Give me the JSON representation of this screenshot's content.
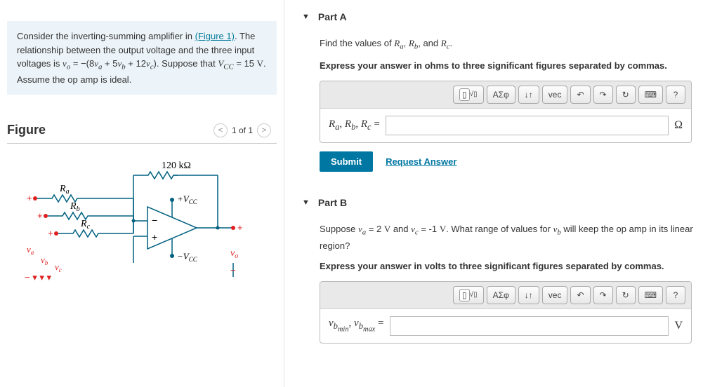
{
  "prompt": {
    "line1_pre": "Consider the inverting-summing amplifier in ",
    "figure_link": "(Figure 1)",
    "line1_post": ". The relationship between the output voltage and the three input voltages is ",
    "equation": "vₒ = −(8vₐ + 5v_b + 12v_c)",
    "suppose": ". Suppose that ",
    "vcc": "V_CC = 15 V",
    "assume": ". Assume the op amp is ideal."
  },
  "figure": {
    "title": "Figure",
    "page": "1 of 1",
    "r_feedback": "120 kΩ",
    "r_a": "Rₐ",
    "r_b": "R_b",
    "r_c": "R_c",
    "v_a": "vₐ",
    "v_b": "v_b",
    "v_c": "v_c",
    "v_o": "vₒ",
    "plus_vcc": "+V_CC",
    "minus_vcc": "−V_CC"
  },
  "partA": {
    "title": "Part A",
    "question_pre": "Find the values of ",
    "vars": "Rₐ, R_b, and R_c",
    "question_post": ".",
    "instruction": "Express your answer in ohms to three significant figures separated by commas.",
    "var_label": "Rₐ, R_b, R_c =",
    "unit": "Ω",
    "submit": "Submit",
    "request": "Request Answer"
  },
  "partB": {
    "title": "Part B",
    "question": "Suppose vₐ = 2 V and v_c = -1 V. What range of values for v_b will keep the op amp in its linear region?",
    "instruction": "Express your answer in volts to three significant figures separated by commas.",
    "var_label": "v_bmin, v_bmax =",
    "unit": "V"
  },
  "tools": {
    "template": "▯√▯",
    "greek": "ΑΣφ",
    "subscript": "↓↑",
    "vec": "vec",
    "undo": "↶",
    "redo": "↷",
    "reset": "↻",
    "keyboard": "⌨",
    "help": "?"
  }
}
